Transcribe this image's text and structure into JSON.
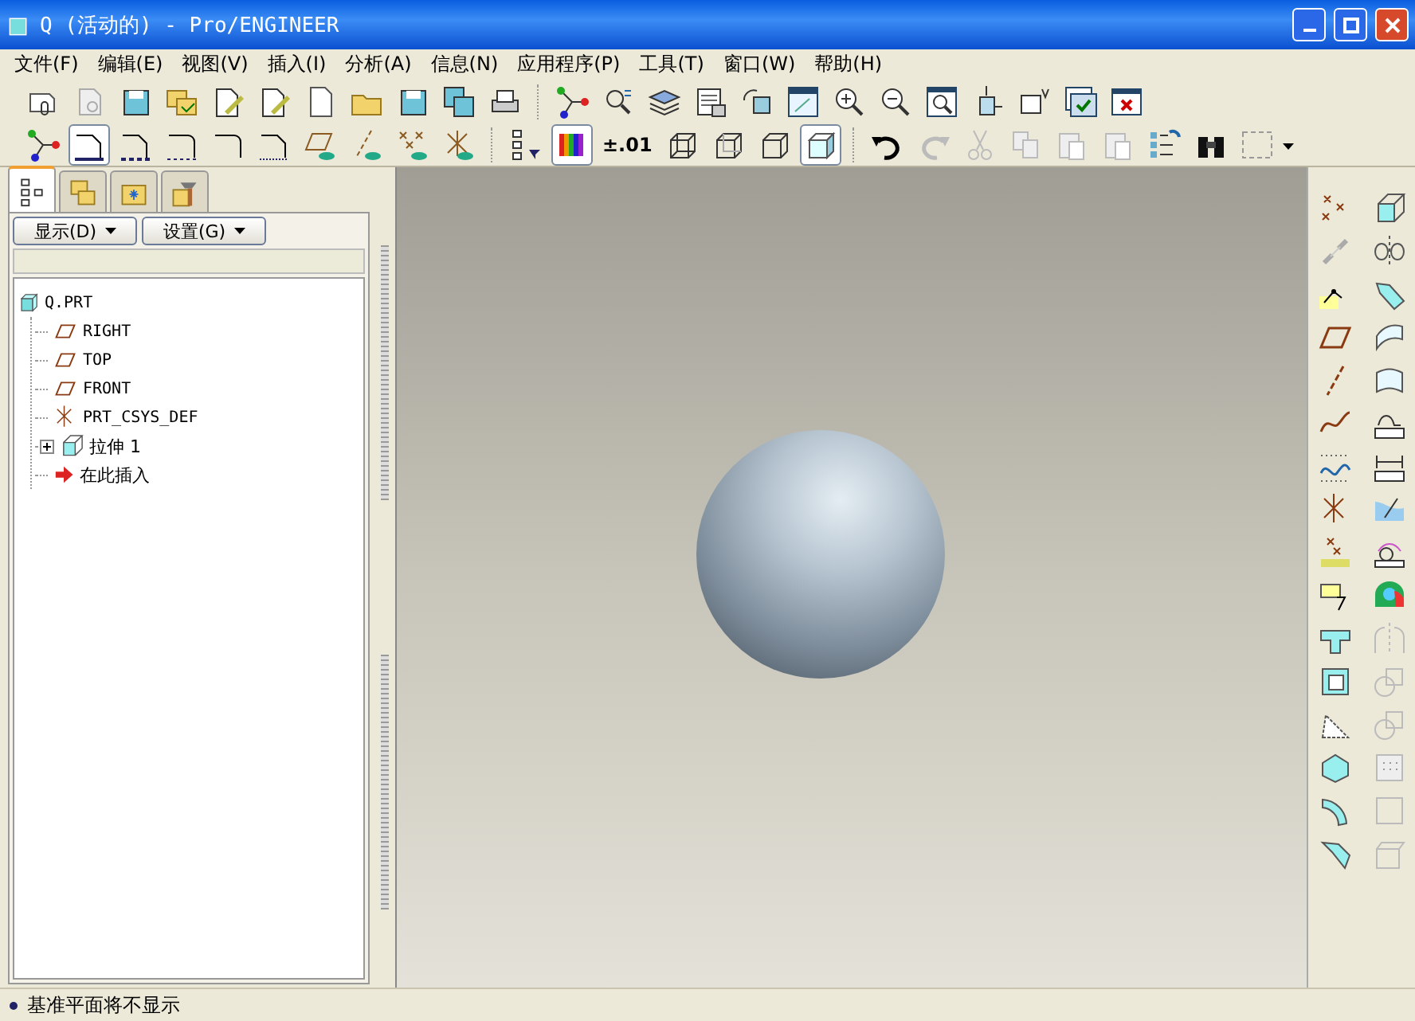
{
  "window": {
    "title": "Q (活动的) - Pro/ENGINEER"
  },
  "menu": [
    {
      "label": "文件(F)"
    },
    {
      "label": "编辑(E)"
    },
    {
      "label": "视图(V)"
    },
    {
      "label": "插入(I)"
    },
    {
      "label": "分析(A)"
    },
    {
      "label": "信息(N)"
    },
    {
      "label": "应用程序(P)"
    },
    {
      "label": "工具(T)"
    },
    {
      "label": "窗口(W)"
    },
    {
      "label": "帮助(H)"
    }
  ],
  "toolbar": {
    "dimension_format": "±.01",
    "display_styles": [
      {
        "selected": false
      },
      {
        "selected": false
      },
      {
        "selected": false
      },
      {
        "selected": true
      }
    ]
  },
  "navigator": {
    "tabs": [
      {
        "selected": true
      },
      {
        "selected": false
      },
      {
        "selected": false
      },
      {
        "selected": false
      }
    ],
    "buttons": [
      {
        "label": "显示(D)"
      },
      {
        "label": "设置(G)"
      }
    ],
    "tree": [
      {
        "label": "Q.PRT",
        "kind": "part",
        "children": [
          {
            "label": "RIGHT",
            "kind": "plane"
          },
          {
            "label": "TOP",
            "kind": "plane"
          },
          {
            "label": "FRONT",
            "kind": "plane"
          },
          {
            "label": "PRT_CSYS_DEF",
            "kind": "csys"
          },
          {
            "label": "拉伸 1",
            "kind": "feature",
            "expanded": false
          },
          {
            "label": "在此插入",
            "kind": "insert"
          }
        ]
      }
    ]
  },
  "status_bar": {
    "message": "基准平面将不显示"
  }
}
